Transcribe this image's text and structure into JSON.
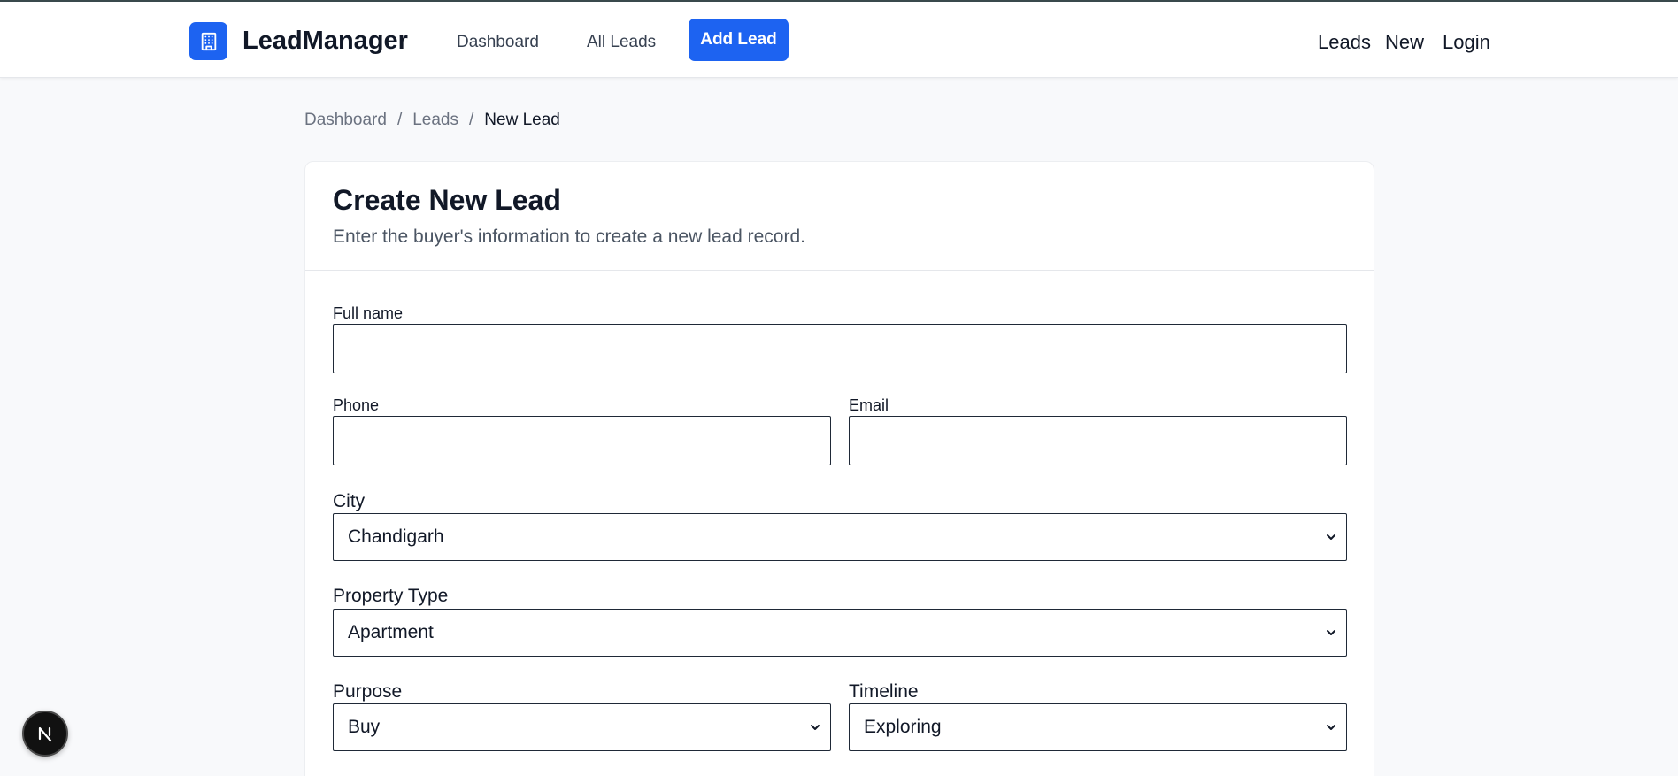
{
  "app": {
    "brand": "LeadManager",
    "brand_color": "#1d63f1"
  },
  "nav": {
    "links": [
      {
        "label": "Dashboard"
      },
      {
        "label": "All Leads"
      }
    ],
    "active_label": "Add Lead",
    "right_links": [
      "Leads",
      "New",
      "Login"
    ]
  },
  "breadcrumb": {
    "items": [
      "Dashboard",
      "Leads"
    ],
    "separator": "/",
    "current": "New Lead"
  },
  "form": {
    "title": "Create New Lead",
    "subtitle": "Enter the buyer's information to create a new lead record.",
    "full_name": {
      "label": "Full name",
      "value": ""
    },
    "phone": {
      "label": "Phone",
      "value": ""
    },
    "email": {
      "label": "Email",
      "value": ""
    },
    "city": {
      "label": "City",
      "value": "Chandigarh"
    },
    "property_type": {
      "label": "Property Type",
      "value": "Apartment"
    },
    "purpose": {
      "label": "Purpose",
      "value": "Buy"
    },
    "timeline": {
      "label": "Timeline",
      "value": "Exploring"
    }
  },
  "icons": {
    "logo": "building-icon",
    "select_arrow": "chevron-down-icon",
    "dev_badge": "nextjs-n-icon"
  }
}
